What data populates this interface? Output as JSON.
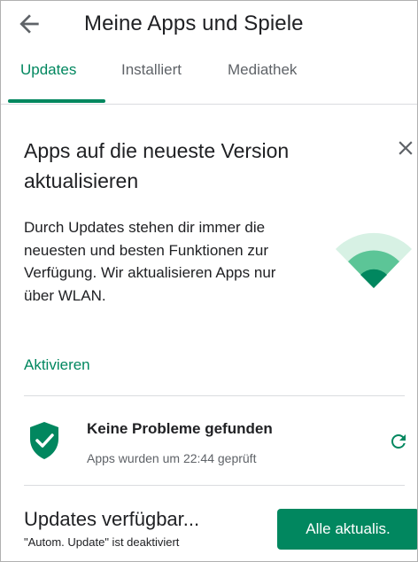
{
  "header": {
    "title": "Meine Apps und Spiele",
    "back_icon": "arrow-back-icon"
  },
  "tabs": [
    {
      "label": "Updates",
      "active": true
    },
    {
      "label": "Installiert",
      "active": false
    },
    {
      "label": "Mediathek",
      "active": false
    }
  ],
  "wlan_card": {
    "title": "Apps auf die neueste Version aktualisieren",
    "body": "Durch Updates stehen dir immer die neuesten und besten Funktionen zur Verfügung. Wir aktualisieren Apps nur über WLAN.",
    "action_label": "Aktivieren",
    "close_icon": "close-icon",
    "illustration_icon": "wifi-icon"
  },
  "status": {
    "title": "Keine Probleme gefunden",
    "subtitle": "Apps wurden um 22:44 geprüft",
    "shield_icon": "shield-check-icon",
    "refresh_icon": "refresh-icon"
  },
  "updates": {
    "title": "Updates verfügbar...",
    "subtitle": "\"Autom. Update\" ist deaktiviert",
    "button_label": "Alle aktualis."
  },
  "colors": {
    "accent": "#01875f",
    "text": "#202124",
    "secondary_text": "#5f6368",
    "divider": "#dadce0"
  }
}
